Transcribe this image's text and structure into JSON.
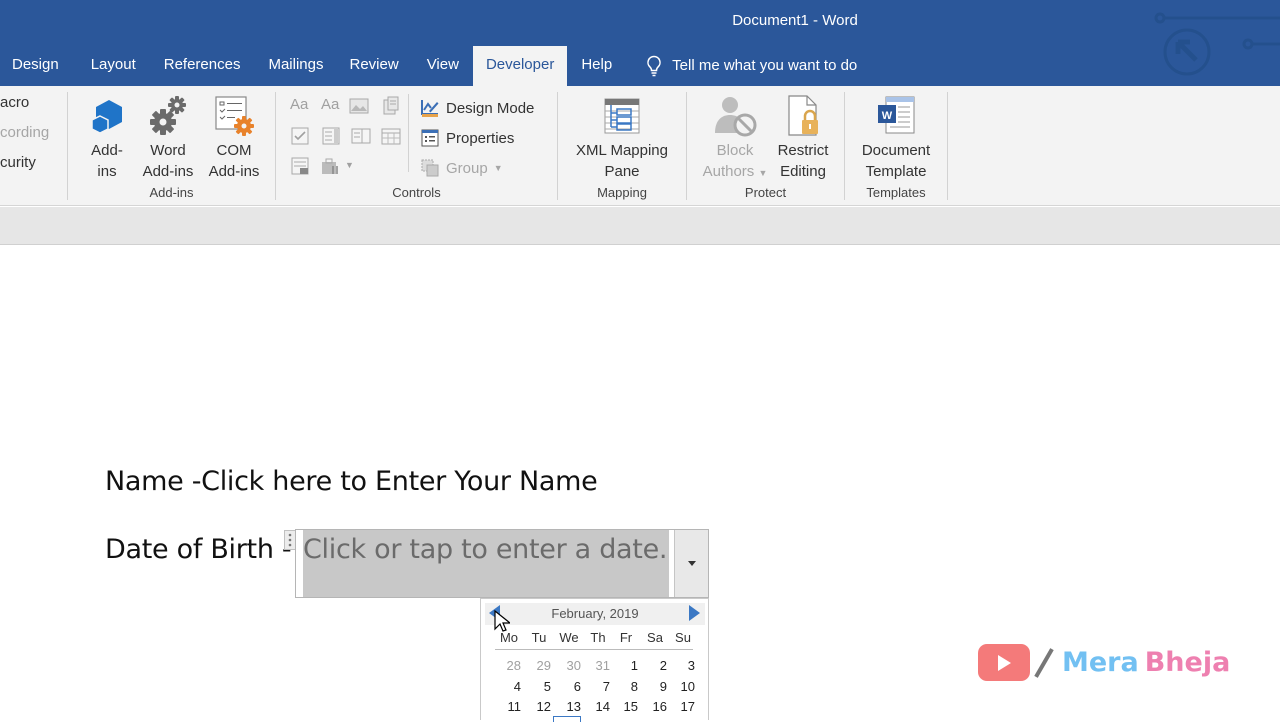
{
  "window": {
    "title": "Document1  -  Word"
  },
  "tabs": [
    {
      "label": "Design",
      "active": false
    },
    {
      "label": "Layout",
      "active": false
    },
    {
      "label": "References",
      "active": false
    },
    {
      "label": "Mailings",
      "active": false
    },
    {
      "label": "Review",
      "active": false
    },
    {
      "label": "View",
      "active": false
    },
    {
      "label": "Developer",
      "active": true
    },
    {
      "label": "Help",
      "active": false
    }
  ],
  "tell_me": {
    "label": "Tell me what you want to do",
    "icon": "lightbulb-icon"
  },
  "ribbon": {
    "code_group": {
      "items": [
        "acro",
        "cording",
        "curity"
      ]
    },
    "addins_group": {
      "label": "Add-ins",
      "buttons": [
        {
          "line1": "Add-",
          "line2": "ins",
          "icon": "addins-cube-icon"
        },
        {
          "line1": "Word",
          "line2": "Add-ins",
          "icon": "gears-icon"
        },
        {
          "line1": "COM",
          "line2": "Add-ins",
          "icon": "com-addins-icon"
        }
      ]
    },
    "controls_group": {
      "label": "Controls",
      "design_mode": "Design Mode",
      "properties": "Properties",
      "group": "Group"
    },
    "mapping_group": {
      "label": "Mapping",
      "xml_line1": "XML Mapping",
      "xml_line2": "Pane"
    },
    "protect_group": {
      "label": "Protect",
      "block_line1": "Block",
      "block_line2": "Authors",
      "restrict_line1": "Restrict",
      "restrict_line2": "Editing"
    },
    "templates_group": {
      "label": "Templates",
      "doc_line1": "Document",
      "doc_line2": "Template"
    }
  },
  "document": {
    "name_line": "Name -Click here to Enter Your Name",
    "dob_label": "Date of Birth -",
    "date_placeholder": "Click or tap to enter a date."
  },
  "calendar": {
    "month_year": "February, 2019",
    "weekdays": [
      "Mo",
      "Tu",
      "We",
      "Th",
      "Fr",
      "Sa",
      "Su"
    ],
    "weeks": [
      [
        {
          "d": "28",
          "o": true
        },
        {
          "d": "29",
          "o": true
        },
        {
          "d": "30",
          "o": true
        },
        {
          "d": "31",
          "o": true
        },
        {
          "d": "1"
        },
        {
          "d": "2"
        },
        {
          "d": "3"
        }
      ],
      [
        {
          "d": "4"
        },
        {
          "d": "5"
        },
        {
          "d": "6"
        },
        {
          "d": "7"
        },
        {
          "d": "8"
        },
        {
          "d": "9"
        },
        {
          "d": "10"
        }
      ],
      [
        {
          "d": "11"
        },
        {
          "d": "12"
        },
        {
          "d": "13"
        },
        {
          "d": "14"
        },
        {
          "d": "15"
        },
        {
          "d": "16"
        },
        {
          "d": "17"
        }
      ]
    ]
  },
  "watermark": {
    "part1": "Mera",
    "part2": "Bheja"
  }
}
